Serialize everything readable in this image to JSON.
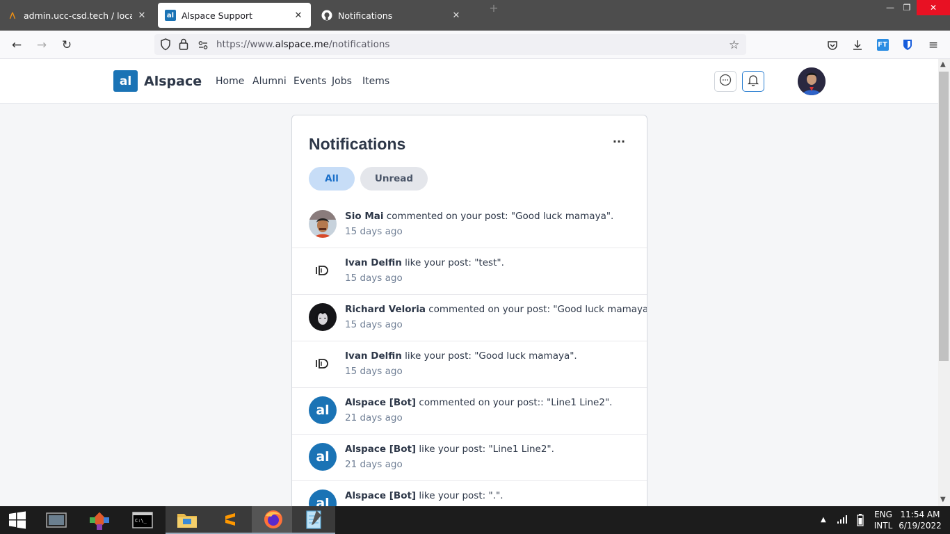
{
  "browser": {
    "tabs": [
      {
        "title": "admin.ucc-csd.tech / localhost",
        "active": false
      },
      {
        "title": "Alspace Support",
        "active": true
      },
      {
        "title": "Notifications",
        "active": false
      }
    ],
    "url_prefix": "https://www.",
    "url_domain": "alspace.me",
    "url_path": "/notifications"
  },
  "site": {
    "logo_text": "al",
    "brand": "Alspace",
    "nav": [
      "Home",
      "Alumni",
      "Events",
      "Jobs",
      "Items"
    ]
  },
  "notifications_card": {
    "title": "Notifications",
    "more_label": "···",
    "filters": {
      "all": "All",
      "unread": "Unread"
    },
    "items": [
      {
        "name": "Sio Mai",
        "action": " commented on your post: \"Good luck mamaya\".",
        "time": "15 days ago",
        "avatar": "photo"
      },
      {
        "name": "Ivan Delfin",
        "action": " like your post: \"test\".",
        "time": "15 days ago",
        "avatar": "id-logo"
      },
      {
        "name": "Richard Veloria",
        "action": " commented on your post: \"Good luck mamaya\".",
        "time": "15 days ago",
        "avatar": "photo-dark"
      },
      {
        "name": "Ivan Delfin",
        "action": " like your post: \"Good luck mamaya\".",
        "time": "15 days ago",
        "avatar": "id-logo"
      },
      {
        "name": "Alspace [Bot]",
        "action": " commented on your post:: \"Line1 Line2\".",
        "time": "21 days ago",
        "avatar": "al"
      },
      {
        "name": "Alspace [Bot]",
        "action": " like your post: \"Line1 Line2\".",
        "time": "21 days ago",
        "avatar": "al"
      },
      {
        "name": "Alspace [Bot]",
        "action": " like your post: \".\".",
        "time": "",
        "avatar": "al"
      }
    ]
  },
  "taskbar": {
    "lang": "ENG",
    "layout": "INTL",
    "time": "11:54 AM",
    "date": "6/19/2022"
  }
}
